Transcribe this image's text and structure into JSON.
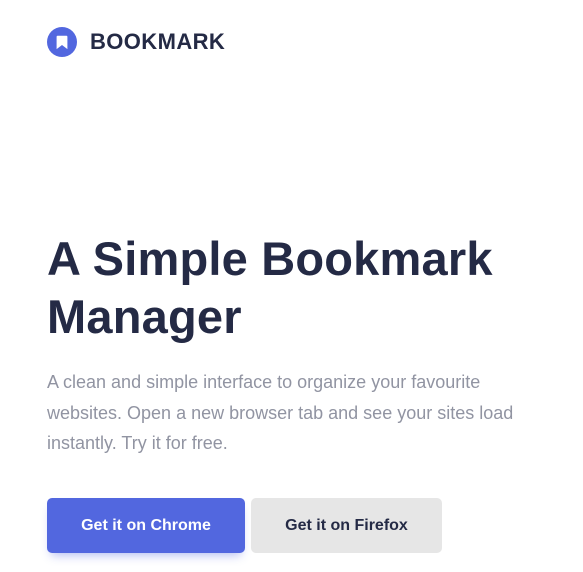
{
  "header": {
    "logo_icon": "bookmark-icon",
    "logo_text": "BOOKMARK"
  },
  "hero": {
    "title": "A Simple Bookmark Manager",
    "subtitle": "A clean and simple interface to organize your favourite websites. Open a new browser tab and see your sites load instantly. Try it for free."
  },
  "buttons": {
    "chrome_label": "Get it on Chrome",
    "firefox_label": "Get it on Firefox"
  },
  "colors": {
    "primary": "#5267df",
    "dark_text": "#242a45",
    "muted_text": "#9194a2",
    "secondary_button": "#e6e6e6"
  }
}
